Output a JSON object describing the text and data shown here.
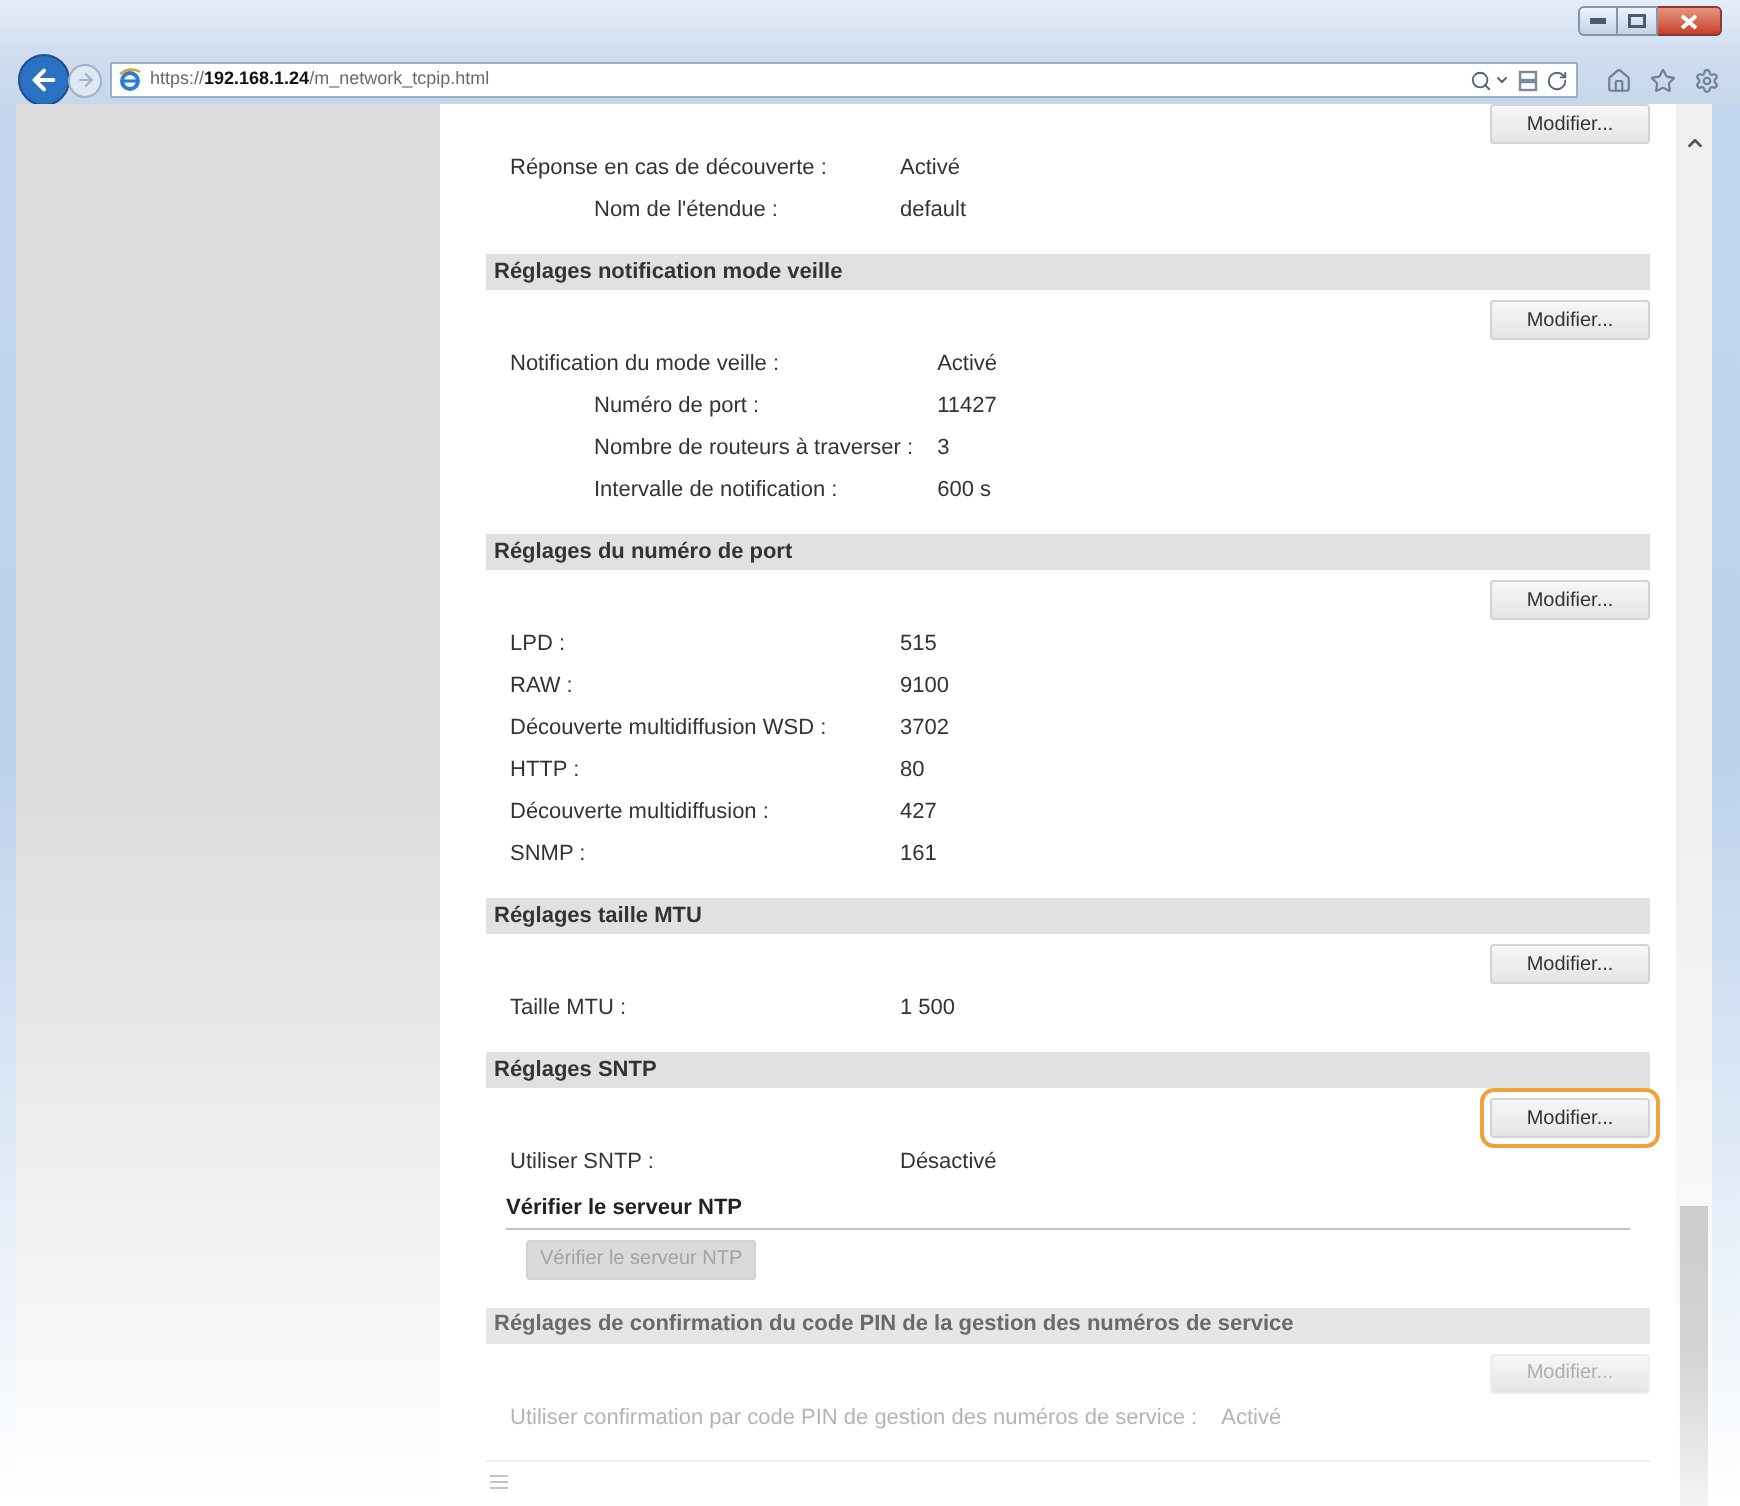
{
  "browser": {
    "address": "https://**192.168.1.24**/m_network_tcpip.html"
  },
  "sections": [
    {
      "button": {
        "label": "Modifier...",
        "highlighted": false
      },
      "rows": [
        {
          "label": "Réponse en cas de découverte :",
          "value": "Activé",
          "children": [
            {
              "label": "Nom de l'étendue :",
              "value": "default"
            }
          ]
        }
      ]
    },
    {
      "title": "Réglages notification mode veille",
      "button": {
        "label": "Modifier...",
        "highlighted": false
      },
      "rows": [
        {
          "label": "Notification du mode veille :",
          "value": "Activé",
          "children": [
            {
              "label": "Numéro de port :",
              "value": "11427"
            },
            {
              "label": "Nombre de routeurs à traverser :",
              "value": "3"
            },
            {
              "label": "Intervalle de notification :",
              "value": "600 s"
            }
          ]
        }
      ]
    },
    {
      "title": "Réglages du numéro de port",
      "button": {
        "label": "Modifier...",
        "highlighted": false
      },
      "rows": [
        {
          "label": "LPD :",
          "value": "515"
        },
        {
          "label": "RAW :",
          "value": "9100"
        },
        {
          "label": "Découverte multidiffusion WSD :",
          "value": "3702"
        },
        {
          "label": "HTTP :",
          "value": "80"
        },
        {
          "label": "Découverte multidiffusion :",
          "value": "427"
        },
        {
          "label": "SNMP :",
          "value": "161"
        }
      ]
    },
    {
      "title": "Réglages taille MTU",
      "button": {
        "label": "Modifier...",
        "highlighted": false
      },
      "rows": [
        {
          "label": "Taille MTU :",
          "value": "1 500"
        }
      ]
    },
    {
      "title": "Réglages SNTP",
      "button": {
        "label": "Modifier...",
        "highlighted": true
      },
      "rows": [
        {
          "label": "Utiliser SNTP :",
          "value": "Désactivé"
        }
      ],
      "subsection": {
        "title": "Vérifier le serveur NTP",
        "button": {
          "label": "Vérifier le serveur NTP",
          "disabled": true
        }
      }
    },
    {
      "title": "Réglages de confirmation du code PIN de la gestion des numéros de service",
      "button": {
        "label": "Modifier...",
        "highlighted": false
      },
      "rows": [
        {
          "label": "Utiliser confirmation par code PIN de gestion des numéros de service :",
          "value": "Activé"
        }
      ]
    }
  ]
}
